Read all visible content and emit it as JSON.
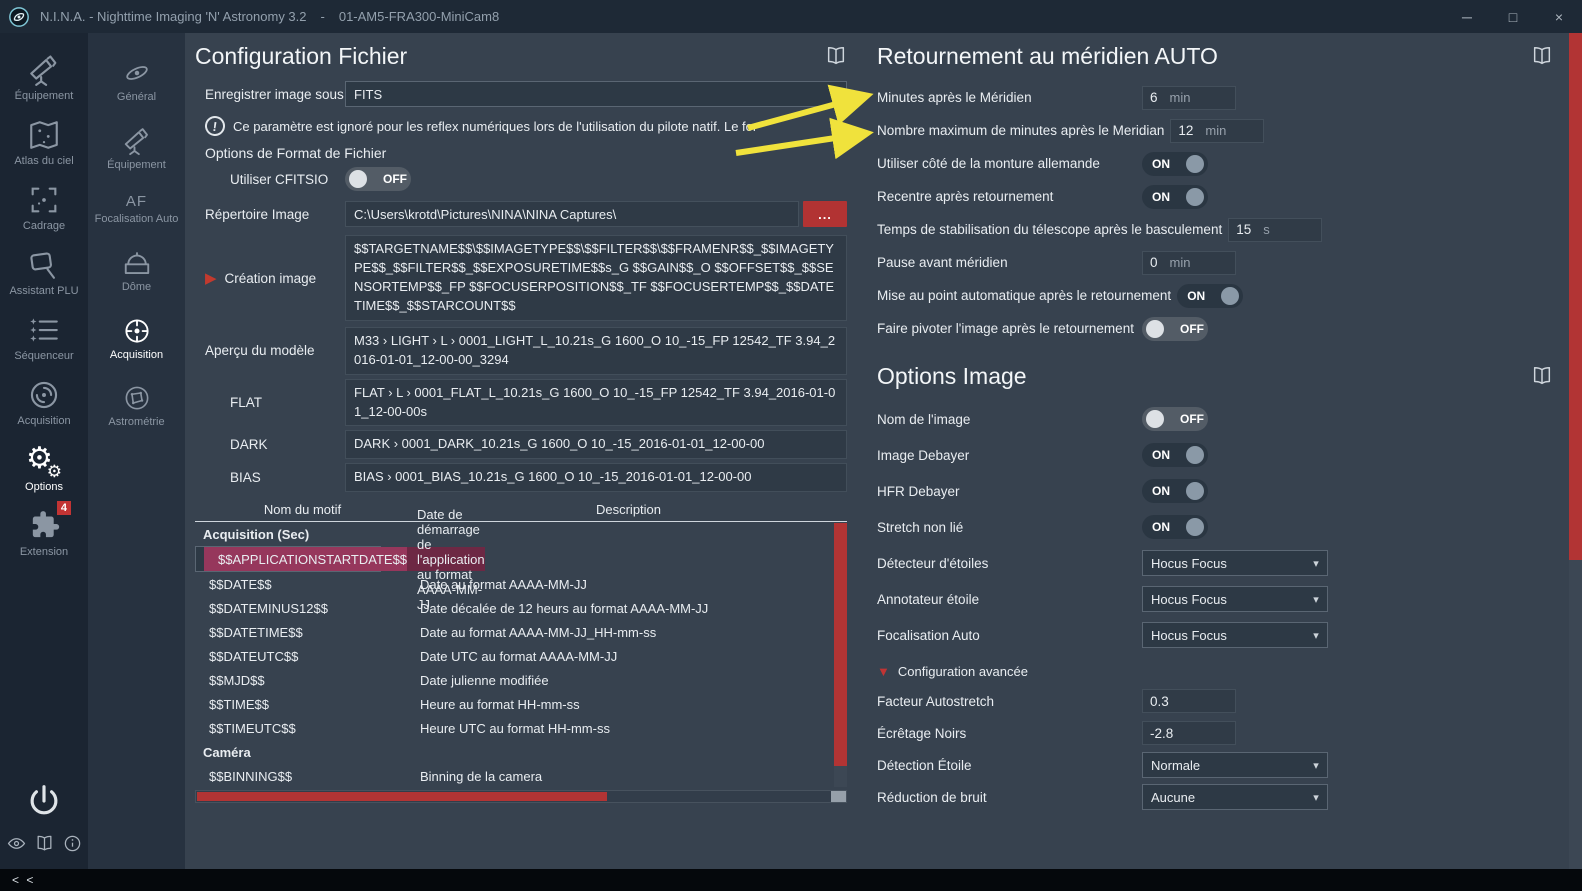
{
  "window": {
    "title": "N.I.N.A. - Nighttime Imaging 'N' Astronomy 3.2",
    "separator": "-",
    "profile": "01-AM5-FRA300-MiniCam8"
  },
  "icons": {
    "minimize": "─",
    "maximize": "□",
    "close": "×",
    "chevron_down": "▾",
    "play": "▶",
    "expander": "▼",
    "warning": "!",
    "gear": "⚙"
  },
  "nav": {
    "collapse": "< <",
    "items": [
      {
        "label": "Équipement"
      },
      {
        "label": "Atlas du ciel"
      },
      {
        "label": "Cadrage"
      },
      {
        "label": "Assistant PLU"
      },
      {
        "label": "Séquenceur"
      },
      {
        "label": "Acquisition"
      },
      {
        "label": "Options"
      },
      {
        "label": "Extension",
        "badge": "4"
      }
    ]
  },
  "subnav": {
    "items": [
      {
        "label": "Général"
      },
      {
        "label": "Équipement"
      },
      {
        "label": "Focalisation Auto",
        "icon_text": "AF"
      },
      {
        "label": "Dôme"
      },
      {
        "label": "Acquisition"
      },
      {
        "label": "Astrométrie"
      }
    ]
  },
  "file_settings": {
    "title": "Configuration Fichier",
    "save_as_label": "Enregistrer image sous",
    "save_as_value": "FITS",
    "warning_text": "Ce paramètre est ignoré pour les reflex numériques lors de l'utilisation du pilote natif. Le for",
    "format_options_heading": "Options de Format de Fichier",
    "cfitsio_label": "Utiliser CFITSIO",
    "cfitsio_state": "OFF",
    "image_dir_label": "Répertoire Image",
    "image_dir_value": "C:\\Users\\krotd\\Pictures\\NINA\\NINA Captures\\",
    "browse_label": "...",
    "creation_label": "Création image",
    "pattern_value": "$$TARGETNAME$$\\$$IMAGETYPE$$\\$$FILTER$$\\$$FRAMENR$$_$$IMAGETYPE$$_$$FILTER$$_$$EXPOSURETIME$$s_G $$GAIN$$_O $$OFFSET$$_$$SENSORTEMP$$_FP $$FOCUSERPOSITION$$_TF $$FOCUSERTEMP$$_$$DATETIME$$_$$STARCOUNT$$",
    "preview_label": "Aperçu du modèle",
    "preview_value": "M33 › LIGHT › L › 0001_LIGHT_L_10.21s_G 1600_O 10_-15_FP 12542_TF 3.94_2016-01-01_12-00-00_3294",
    "flat_label": "FLAT",
    "flat_value": "FLAT › L › 0001_FLAT_L_10.21s_G 1600_O 10_-15_FP 12542_TF 3.94_2016-01-01_12-00-00s",
    "dark_label": "DARK",
    "dark_value": "DARK › 0001_DARK_10.21s_G 1600_O 10_-15_2016-01-01_12-00-00",
    "bias_label": "BIAS",
    "bias_value": "BIAS › 0001_BIAS_10.21s_G 1600_O 10_-15_2016-01-01_12-00-00",
    "table": {
      "header_name": "Nom du motif",
      "header_desc": "Description",
      "rows": [
        {
          "name": "Acquisition (Sec)",
          "desc": ""
        },
        {
          "name": "$$APPLICATIONSTARTDATE$$",
          "desc": "Date de démarrage de l'application au format AAAA-MM-JJ"
        },
        {
          "name": "$$DATE$$",
          "desc": "Date au format AAAA-MM-JJ"
        },
        {
          "name": "$$DATEMINUS12$$",
          "desc": "Date décalée de 12 heurs au format AAAA-MM-JJ"
        },
        {
          "name": "$$DATETIME$$",
          "desc": "Date au format AAAA-MM-JJ_HH-mm-ss"
        },
        {
          "name": "$$DATEUTC$$",
          "desc": "Date UTC au format AAAA-MM-JJ"
        },
        {
          "name": "$$MJD$$",
          "desc": "Date julienne modifiée"
        },
        {
          "name": "$$TIME$$",
          "desc": "Heure au format HH-mm-ss"
        },
        {
          "name": "$$TIMEUTC$$",
          "desc": "Heure UTC au format HH-mm-ss"
        },
        {
          "name": "Caméra",
          "desc": ""
        },
        {
          "name": "$$BINNING$$",
          "desc": "Binning de la camera"
        }
      ]
    }
  },
  "meridian": {
    "title": "Retournement au méridien AUTO",
    "minutes_after_label": "Minutes après le Méridien",
    "minutes_after_value": "6",
    "minutes_after_unit": "min",
    "max_minutes_label": "Nombre maximum de minutes après le Meridian",
    "max_minutes_value": "12",
    "max_minutes_unit": "min",
    "gem_side_label": "Utiliser côté de la monture allemande",
    "gem_side_state": "ON",
    "recenter_label": "Recentre après retournement",
    "recenter_state": "ON",
    "settle_label": "Temps de stabilisation du télescope après le basculement",
    "settle_value": "15",
    "settle_unit": "s",
    "pause_label": "Pause avant méridien",
    "pause_value": "0",
    "pause_unit": "min",
    "autofocus_label": "Mise au point automatique après le retournement",
    "autofocus_state": "ON",
    "rotate_label": "Faire pivoter l'image après le retournement",
    "rotate_state": "OFF"
  },
  "image_options": {
    "title": "Options Image",
    "image_name_label": "Nom de l'image",
    "image_name_state": "OFF",
    "debayer_label": "Image Debayer",
    "debayer_state": "ON",
    "hfr_label": "HFR Debayer",
    "hfr_state": "ON",
    "stretch_label": "Stretch non lié",
    "stretch_state": "ON",
    "star_detector_label": "Détecteur d'étoiles",
    "star_detector_value": "Hocus Focus",
    "star_annotator_label": "Annotateur étoile",
    "star_annotator_value": "Hocus Focus",
    "autofocus_label": "Focalisation Auto",
    "autofocus_value": "Hocus Focus",
    "advanced_heading": "Configuration avancée",
    "autostretch_label": "Facteur Autostretch",
    "autostretch_value": "0.3",
    "black_clipping_label": "Écrêtage Noirs",
    "black_clipping_value": "-2.8",
    "star_sensitivity_label": "Détection Étoile",
    "star_sensitivity_value": "Normale",
    "noise_reduction_label": "Réduction de bruit",
    "noise_reduction_value": "Aucune"
  }
}
